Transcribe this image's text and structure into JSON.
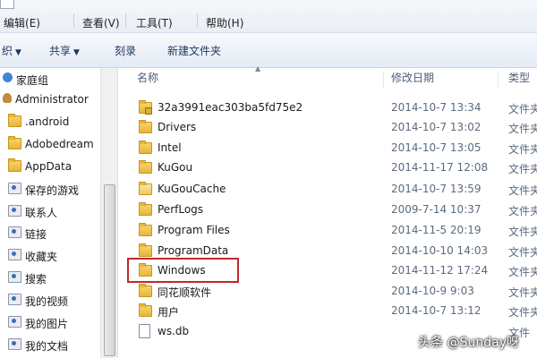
{
  "menubar": {
    "items": [
      {
        "label": "(E)",
        "full": "编辑(E)"
      },
      {
        "label": "查看(V)"
      },
      {
        "label": "工具(T)"
      },
      {
        "label": "帮助(H)"
      }
    ]
  },
  "toolbar": {
    "organize_fragment": "织",
    "share_label": "共享",
    "burn_label": "刻录",
    "new_folder_label": "新建文件夹"
  },
  "nav": {
    "items": [
      {
        "label": "家庭组",
        "icon": "homegroup-icon"
      },
      {
        "label": "Administrator",
        "icon": "user-icon"
      },
      {
        "label": ".android",
        "icon": "folder-icon"
      },
      {
        "label": "Adobedream",
        "icon": "folder-icon"
      },
      {
        "label": "AppData",
        "icon": "folder-icon"
      },
      {
        "label": "保存的游戏",
        "icon": "saved-games-icon"
      },
      {
        "label": "联系人",
        "icon": "contacts-icon"
      },
      {
        "label": "链接",
        "icon": "links-icon"
      },
      {
        "label": "收藏夹",
        "icon": "favorites-icon"
      },
      {
        "label": "搜索",
        "icon": "searches-icon"
      },
      {
        "label": "我的视频",
        "icon": "videos-icon"
      },
      {
        "label": "我的图片",
        "icon": "pictures-icon"
      },
      {
        "label": "我的文档",
        "icon": "documents-icon"
      }
    ]
  },
  "list": {
    "columns": {
      "name": "名称",
      "date": "修改日期",
      "type": "类型"
    },
    "rows": [
      {
        "name": "32a3991eac303ba5fd75e2",
        "date": "2014-10-7 13:34",
        "type": "文件夹",
        "icon": "locked-folder-icon"
      },
      {
        "name": "Drivers",
        "date": "2014-10-7 13:02",
        "type": "文件夹",
        "icon": "folder-icon"
      },
      {
        "name": "Intel",
        "date": "2014-10-7 13:05",
        "type": "文件夹",
        "icon": "folder-icon"
      },
      {
        "name": "KuGou",
        "date": "2014-11-17 12:08",
        "type": "文件夹",
        "icon": "folder-icon"
      },
      {
        "name": "KuGouCache",
        "date": "2014-10-7 13:59",
        "type": "文件夹",
        "icon": "open-folder-icon"
      },
      {
        "name": "PerfLogs",
        "date": "2009-7-14 10:37",
        "type": "文件夹",
        "icon": "folder-icon"
      },
      {
        "name": "Program Files",
        "date": "2014-11-5 20:19",
        "type": "文件夹",
        "icon": "folder-icon"
      },
      {
        "name": "ProgramData",
        "date": "2014-10-10 14:03",
        "type": "文件夹",
        "icon": "folder-icon"
      },
      {
        "name": "Windows",
        "date": "2014-11-12 17:24",
        "type": "文件夹",
        "icon": "folder-icon"
      },
      {
        "name": "同花顺软件",
        "date": "2014-10-9 9:03",
        "type": "文件夹",
        "icon": "folder-icon"
      },
      {
        "name": "用户",
        "date": "2014-10-7 13:12",
        "type": "文件夹",
        "icon": "folder-icon"
      },
      {
        "name": "ws.db",
        "date": "",
        "type": "文件",
        "icon": "file-icon"
      }
    ]
  },
  "watermark": "头条 @Sunday呀"
}
